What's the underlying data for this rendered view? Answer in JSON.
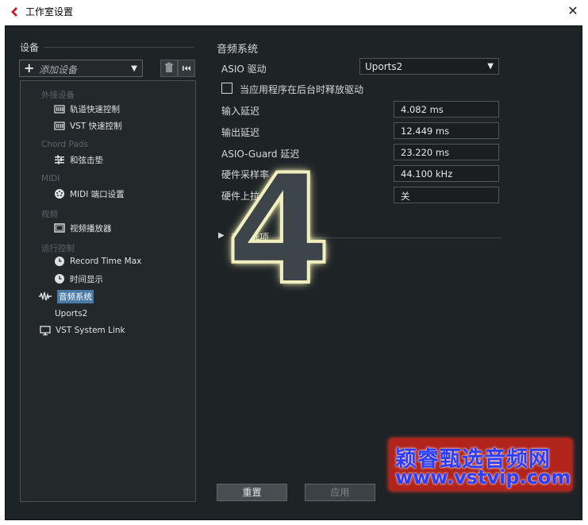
{
  "window": {
    "title": "工作室设置"
  },
  "left": {
    "section_title": "设备",
    "add_device_placeholder": "添加设备",
    "tree": {
      "categories": [
        "外接设备",
        "Chord Pads",
        "MIDI",
        "视频",
        "运行控制"
      ],
      "items": [
        {
          "label": "轨道快速控制",
          "icon": "mixer-icon"
        },
        {
          "label": "VST 快速控制",
          "icon": "mixer-icon"
        },
        {
          "label": "和弦击垫",
          "icon": "sliders-icon"
        },
        {
          "label": "MIDI 端口设置",
          "icon": "midi-port-icon"
        },
        {
          "label": "视频播放器",
          "icon": "film-icon"
        },
        {
          "label": "Record Time Max",
          "icon": "clock-icon"
        },
        {
          "label": "时间显示",
          "icon": "clock-icon"
        },
        {
          "label": "音频系统",
          "icon": "waveform-icon"
        },
        {
          "label": "Uports2",
          "icon": ""
        },
        {
          "label": "VST System Link",
          "icon": "monitor-icon"
        }
      ]
    }
  },
  "right": {
    "section_title": "音频系统",
    "asio_driver_label": "ASIO 驱动",
    "asio_driver_value": "Uports2",
    "release_driver_label": "当应用程序在后台时释放驱动",
    "fields": [
      {
        "label": "输入延迟",
        "value": "4.082 ms"
      },
      {
        "label": "输出延迟",
        "value": "12.449 ms"
      },
      {
        "label": "ASIO-Guard 延迟",
        "value": "23.220 ms"
      },
      {
        "label": "硬件采样率",
        "value": "44.100 kHz"
      },
      {
        "label": "硬件上拉/下拉",
        "value": "关"
      }
    ],
    "advanced_label": "高级选项"
  },
  "buttons": {
    "reset": "重置",
    "apply": "应用"
  },
  "overlay": {
    "step_number": "4",
    "watermark_line1": "颖睿甄选音频网",
    "watermark_line2": "www.vstvip.com"
  }
}
